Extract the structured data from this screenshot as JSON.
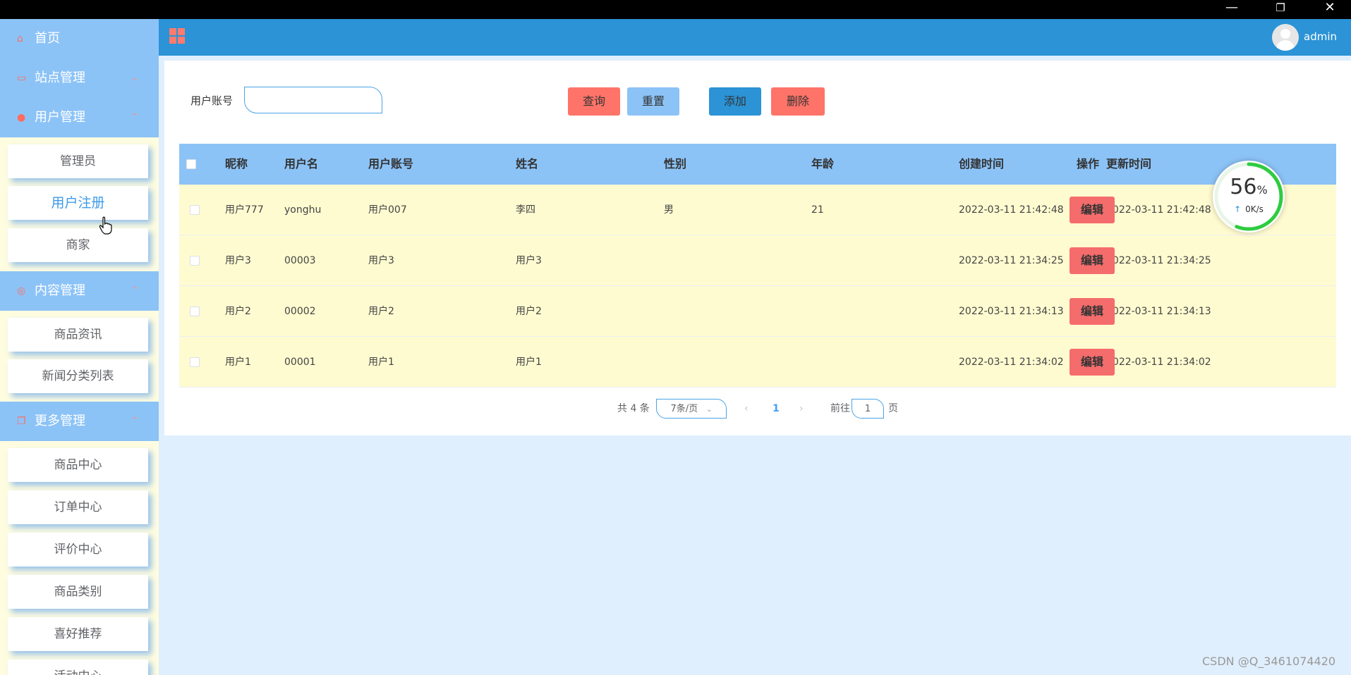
{
  "window": {
    "minimize": "—",
    "restore": "❐",
    "close": "✕"
  },
  "sidebar": {
    "home": {
      "label": "首页",
      "icon": "home-icon"
    },
    "sites": {
      "label": "站点管理",
      "icon": "monitor-icon",
      "chevron": "⌄"
    },
    "users": {
      "label": "用户管理",
      "icon": "user-icon",
      "chevron": "⌃",
      "items": [
        "管理员",
        "用户注册",
        "商家"
      ]
    },
    "content": {
      "label": "内容管理",
      "icon": "content-icon",
      "chevron": "⌃",
      "items": [
        "商品资讯",
        "新闻分类列表"
      ]
    },
    "more": {
      "label": "更多管理",
      "icon": "copy-icon",
      "chevron": "⌃",
      "items": [
        "商品中心",
        "订单中心",
        "评价中心",
        "商品类别",
        "喜好推荐",
        "活动中心"
      ]
    }
  },
  "header": {
    "username": "admin"
  },
  "search": {
    "label": "用户账号",
    "value": "",
    "placeholder": ""
  },
  "toolbar": {
    "query": "查询",
    "reset": "重置",
    "add": "添加",
    "delete": "删除"
  },
  "table": {
    "headers": {
      "nickname": "昵称",
      "username": "用户名",
      "account": "用户账号",
      "name": "姓名",
      "gender": "性别",
      "age": "年龄",
      "created": "创建时间",
      "updated": "更新时间",
      "actions": "操作"
    },
    "sort_icon": "⇳",
    "edit_label": "编辑",
    "rows": [
      {
        "nickname": "用户777",
        "username": "yonghu",
        "account": "用户007",
        "name": "李四",
        "gender": "男",
        "age": "21",
        "created": "2022-03-11 21:42:48",
        "updated": "2022-03-11 21:42:48"
      },
      {
        "nickname": "用户3",
        "username": "00003",
        "account": "用户3",
        "name": "用户3",
        "gender": "",
        "age": "",
        "created": "2022-03-11 21:34:25",
        "updated": "2022-03-11 21:34:25"
      },
      {
        "nickname": "用户2",
        "username": "00002",
        "account": "用户2",
        "name": "用户2",
        "gender": "",
        "age": "",
        "created": "2022-03-11 21:34:13",
        "updated": "2022-03-11 21:34:13"
      },
      {
        "nickname": "用户1",
        "username": "00001",
        "account": "用户1",
        "name": "用户1",
        "gender": "",
        "age": "",
        "created": "2022-03-11 21:34:02",
        "updated": "2022-03-11 21:34:02"
      }
    ]
  },
  "pagination": {
    "total": "共 4 条",
    "page_size": "7条/页",
    "prev": "‹",
    "current": "1",
    "next": "›",
    "goto_prefix": "前往",
    "goto_value": "1",
    "goto_suffix": "页"
  },
  "speed_widget": {
    "percent": "56",
    "percent_sign": "%",
    "rate": "0K/s",
    "arrow": "↑",
    "progress": 0.56
  },
  "watermark": "CSDN @Q_3461074420",
  "colors": {
    "header": "#2b93d6",
    "sidebar_head": "#8cc3f7",
    "accent_red": "#ff7369",
    "row_bg": "#fffbd0",
    "page_bg": "#e0effd"
  }
}
